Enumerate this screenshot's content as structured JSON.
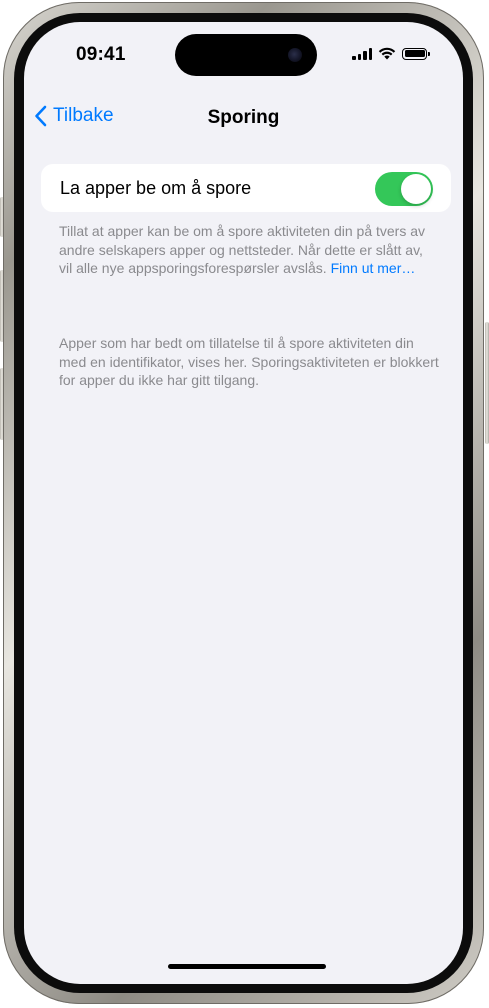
{
  "status_bar": {
    "time": "09:41",
    "icons": [
      "signal-icon",
      "wifi-icon",
      "battery-icon"
    ]
  },
  "nav": {
    "back_label": "Tilbake",
    "title": "Sporing"
  },
  "setting": {
    "label": "La apper be om å spore",
    "toggle_on": true
  },
  "footer1": {
    "text": "Tillat at apper kan be om å spore aktiviteten din på tvers av andre selskapers apper og nettsteder. Når dette er slått av, vil alle nye appsporingsforespørsler avslås.",
    "link_label": "Finn ut mer…"
  },
  "footer2": {
    "text": "Apper som har bedt om tillatelse til å spore aktiviteten din med en identifikator, vises her. Sporingsaktiviteten er blokkert for apper du ikke har gitt tilgang."
  },
  "colors": {
    "accent": "#007aff",
    "toggle_on": "#34c759",
    "background": "#f2f2f7",
    "secondary_text": "#8a8a8e"
  }
}
